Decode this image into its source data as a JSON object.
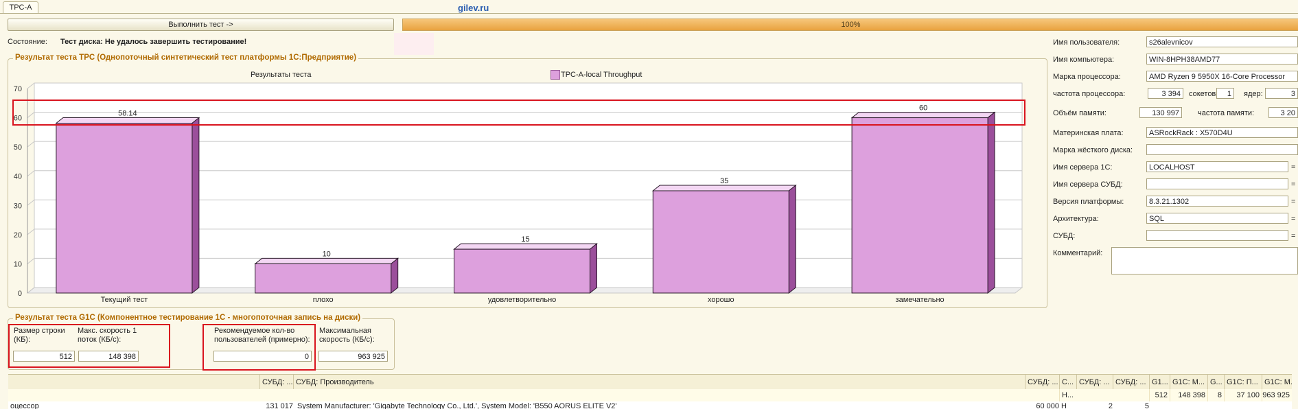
{
  "tab": {
    "label": "TPC-A"
  },
  "logo": "gilev.ru",
  "toolbar": {
    "run_label": "Выполнить тест ->",
    "progress_text": "100%",
    "progress": 1.0
  },
  "state": {
    "label": "Состояние:",
    "value": "Тест диска: Не удалось завершить тестирование!"
  },
  "tpc_group": {
    "title": "Результат теста TPC (Однопоточный синтетический тест платформы 1С:Предприятие)"
  },
  "chart_data": {
    "type": "bar",
    "title": "Результаты теста",
    "categories": [
      "Текущий тест",
      "плохо",
      "удовлетворительно",
      "хорошо",
      "замечательно"
    ],
    "series": [
      {
        "name": "TPC-A-local Throughput",
        "values": [
          58.14,
          10,
          15,
          35,
          60
        ]
      }
    ],
    "value_labels": [
      "58.14",
      "10",
      "15",
      "35",
      "60"
    ],
    "ylim": [
      0,
      70
    ],
    "yticks": [
      0,
      10,
      20,
      30,
      40,
      50,
      60,
      70
    ],
    "color": "#dda0dd",
    "grid": true,
    "legend": "top"
  },
  "g1c_group": {
    "title": "Результат теста G1C (Компонентное тестирование 1С - многопоточная запись на диски)",
    "row_size_label": "Размер строки (КБ):",
    "row_size_value": "512",
    "max_speed1_label": "Макс. скорость 1 поток (КБ/с):",
    "max_speed1_value": "148 398",
    "rec_users_label": "Рекомендуемое кол-во пользователей (примерно):",
    "rec_users_value": "0",
    "max_speed_label": "Максимальная скорость (КБ/с):",
    "max_speed_value": "963 925"
  },
  "info": {
    "user_label": "Имя пользователя:",
    "user_value": "s26alevnicov",
    "computer_label": "Имя компьютера:",
    "computer_value": "WIN-8HPH38AMD77",
    "cpu_label": "Марка процессора:",
    "cpu_value": "AMD Ryzen 9 5950X 16-Core Processor",
    "freq_label": "частота процессора:",
    "freq_value": "3 394",
    "sockets_label": "сокетов:",
    "sockets_value": "1",
    "cores_label": "ядер:",
    "cores_value": "3",
    "mem_label": "Объём памяти:",
    "mem_value": "130 997",
    "memfreq_label": "частота памяти:",
    "memfreq_value": "3 20",
    "mb_label": "Материнская плата:",
    "mb_value": "ASRockRack : X570D4U",
    "hdd_label": "Марка жёсткого диска:",
    "hdd_value": "",
    "server1c_label": "Имя сервера 1С:",
    "server1c_value": "LOCALHOST",
    "serverdb_label": "Имя сервера СУБД:",
    "serverdb_value": "",
    "platform_label": "Версия платформы:",
    "platform_value": "8.3.21.1302",
    "arch_label": "Архитектура:",
    "arch_value": "SQL",
    "dbms_label": "СУБД:",
    "dbms_value": "",
    "comment_label": "Комментарий:",
    "comment_value": "",
    "eq": "="
  },
  "grid": {
    "headers": [
      "",
      "СУБД: ...",
      "СУБД: Производитель",
      "СУБД: ...",
      "С...",
      "СУБД: ...",
      "СУБД: ...",
      "G1...",
      "G1C: M...",
      "G...",
      "G1C: П...",
      "G1C: M..."
    ],
    "row2": [
      "Н...",
      "512",
      "148 398",
      "8",
      "37 100",
      "963 925"
    ],
    "row3": [
      "оцессор",
      "131 017",
      "System Manufacturer: 'Gigabyte Technology Co., Ltd.', System Model: 'B550 AORUS ELITE V2'",
      "60 000",
      "Н",
      "2",
      "5"
    ]
  }
}
